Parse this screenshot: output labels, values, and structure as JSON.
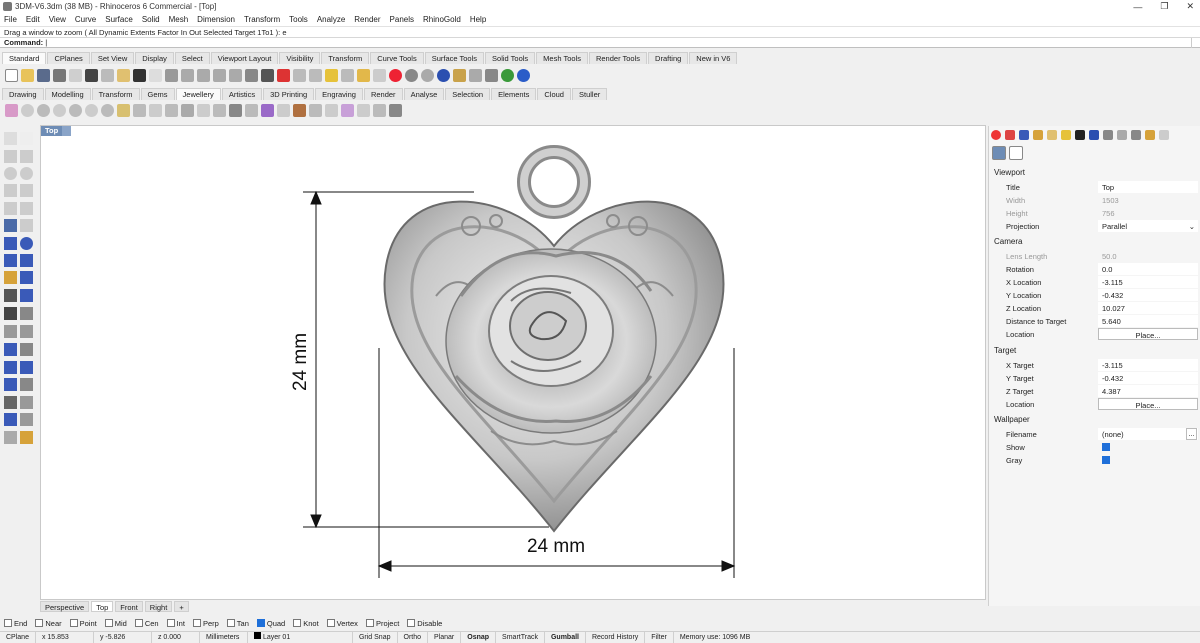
{
  "window": {
    "title": "3DM-V6.3dm (38 MB) - Rhinoceros 6 Commercial - [Top]",
    "controls": [
      "—",
      "❐",
      "✕"
    ]
  },
  "menu": [
    "File",
    "Edit",
    "View",
    "Curve",
    "Surface",
    "Solid",
    "Mesh",
    "Dimension",
    "Transform",
    "Tools",
    "Analyze",
    "Render",
    "Panels",
    "RhinoGold",
    "Help"
  ],
  "command": {
    "history": "Drag a window to zoom ( All  Dynamic  Extents  Factor  In  Out  Selected  Target  1To1 ): e",
    "prompt": "Command:"
  },
  "toolbar_tabs": [
    "Standard",
    "CPlanes",
    "Set View",
    "Display",
    "Select",
    "Viewport Layout",
    "Visibility",
    "Transform",
    "Curve Tools",
    "Surface Tools",
    "Solid Tools",
    "Mesh Tools",
    "Render Tools",
    "Drafting",
    "New in V6"
  ],
  "rhinogold_tabs": [
    "Drawing",
    "Modelling",
    "Transform",
    "Gems",
    "Jewellery",
    "Artistics",
    "3D Printing",
    "Engraving",
    "Render",
    "Analyse",
    "Selection",
    "Elements",
    "Cloud",
    "Stuller"
  ],
  "viewport": {
    "label": "Top",
    "dim_vertical": "24 mm",
    "dim_horizontal": "24 mm"
  },
  "viewport_tabs": [
    "Perspective",
    "Top",
    "Front",
    "Right",
    "+"
  ],
  "osnaps": [
    {
      "label": "End",
      "on": false
    },
    {
      "label": "Near",
      "on": false
    },
    {
      "label": "Point",
      "on": false
    },
    {
      "label": "Mid",
      "on": false
    },
    {
      "label": "Cen",
      "on": false
    },
    {
      "label": "Int",
      "on": false
    },
    {
      "label": "Perp",
      "on": false
    },
    {
      "label": "Tan",
      "on": false
    },
    {
      "label": "Quad",
      "on": true
    },
    {
      "label": "Knot",
      "on": false
    },
    {
      "label": "Vertex",
      "on": false
    },
    {
      "label": "Project",
      "on": false
    },
    {
      "label": "Disable",
      "on": false
    }
  ],
  "status": {
    "cplane": "CPlane",
    "x": "x 15.853",
    "y": "y -5.826",
    "z": "z 0.000",
    "units": "Millimeters",
    "layer": "Layer 01",
    "grid_snap": "Grid Snap",
    "ortho": "Ortho",
    "planar": "Planar",
    "osnap": "Osnap",
    "smarttrack": "SmartTrack",
    "gumball": "Gumball",
    "record_history": "Record History",
    "filter": "Filter",
    "memory": "Memory use: 1096 MB"
  },
  "properties": {
    "viewport_header": "Viewport",
    "title_label": "Title",
    "title_value": "Top",
    "width_label": "Width",
    "width_value": "1503",
    "height_label": "Height",
    "height_value": "756",
    "projection_label": "Projection",
    "projection_value": "Parallel",
    "camera_header": "Camera",
    "lens_label": "Lens Length",
    "lens_value": "50.0",
    "rotation_label": "Rotation",
    "rotation_value": "0.0",
    "xloc_label": "X Location",
    "xloc_value": "-3.115",
    "yloc_label": "Y Location",
    "yloc_value": "-0.432",
    "zloc_label": "Z Location",
    "zloc_value": "10.027",
    "dist_label": "Distance to Target",
    "dist_value": "5.640",
    "location_label": "Location",
    "location_button": "Place...",
    "target_header": "Target",
    "xt_label": "X Target",
    "xt_value": "-3.115",
    "yt_label": "Y Target",
    "yt_value": "-0.432",
    "zt_label": "Z Target",
    "zt_value": "4.387",
    "tloc_label": "Location",
    "tloc_button": "Place...",
    "wallpaper_header": "Wallpaper",
    "filename_label": "Filename",
    "filename_value": "(none)",
    "filename_button": "...",
    "show_label": "Show",
    "gray_label": "Gray"
  }
}
